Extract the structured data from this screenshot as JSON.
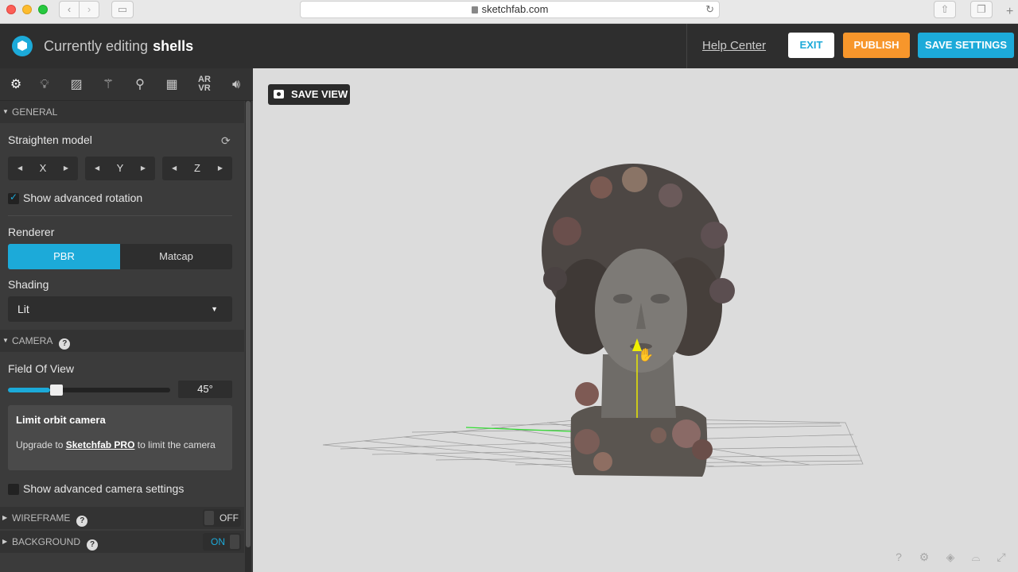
{
  "browser": {
    "url": "sketchfab.com",
    "icons": [
      "back-icon",
      "forward-icon",
      "sidebar-icon",
      "lock-icon",
      "reload-icon",
      "share-icon",
      "tabs-icon",
      "new-tab-icon"
    ]
  },
  "header": {
    "editing_prefix": "Currently editing",
    "model_name": "shells",
    "help_link": "Help Center",
    "exit_label": "EXIT",
    "publish_label": "PUBLISH",
    "save_settings_label": "SAVE SETTINGS",
    "colors": {
      "accent": "#1caad9",
      "publish": "#f7962b",
      "bar": "#2e2e2e"
    }
  },
  "tool_tabs": [
    "gear-icon",
    "lightbulb-icon",
    "image-icon",
    "magic-wand-icon",
    "pin-icon",
    "film-icon",
    "ar-vr-icon",
    "sound-icon"
  ],
  "tool_tab_arvr": {
    "line1": "AR",
    "line2": "VR"
  },
  "general": {
    "title": "GENERAL",
    "straighten_label": "Straighten model",
    "axes": [
      "X",
      "Y",
      "Z"
    ],
    "advanced_rotation_label": "Show advanced rotation",
    "advanced_rotation_checked": true,
    "renderer_label": "Renderer",
    "renderer_options": [
      "PBR",
      "Matcap"
    ],
    "renderer_selected": "PBR",
    "shading_label": "Shading",
    "shading_value": "Lit"
  },
  "camera": {
    "title": "CAMERA",
    "fov_label": "Field Of View",
    "fov_value": "45°",
    "fov_fraction": 0.26,
    "limit_title": "Limit orbit camera",
    "limit_text_before": "Upgrade to ",
    "limit_link": "Sketchfab PRO",
    "limit_text_after": " to limit the camera",
    "advanced_camera_label": "Show advanced camera settings",
    "advanced_camera_checked": false
  },
  "wireframe": {
    "title": "WIREFRAME",
    "toggle": "OFF"
  },
  "background": {
    "title": "BACKGROUND",
    "toggle": "ON"
  },
  "viewport": {
    "save_view_label": "SAVE VIEW",
    "bottom_icons": [
      "help-icon",
      "settings-icon",
      "layers-icon",
      "vr-icon",
      "fullscreen-icon"
    ]
  }
}
